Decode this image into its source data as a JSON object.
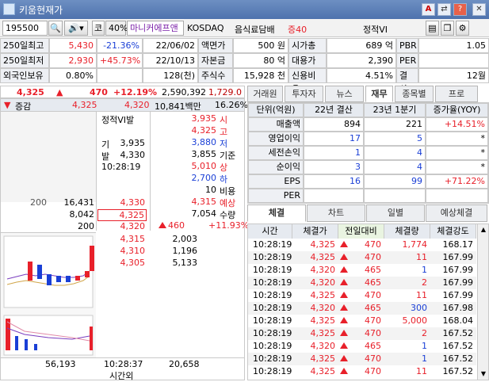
{
  "window": {
    "title": "키움현재가"
  },
  "titlebar_btns": [
    "A",
    "⇄",
    "?",
    "✕"
  ],
  "toolbar": {
    "code": "195500",
    "tag1": "코",
    "margin": "40%",
    "name": "마니커에프앤",
    "market": "KOSDAQ",
    "sector": "음식료담배",
    "rating": "증40",
    "vi": "정적VI"
  },
  "info": {
    "rows": [
      [
        "250일최고",
        "5,430",
        "-21.36%",
        "22/06/02",
        "액면가",
        "500 원",
        "시가총액",
        "689 억",
        "PBR",
        "1.05"
      ],
      [
        "250일최저",
        "2,930",
        "+45.73%",
        "22/10/13",
        "자본금",
        "80 억",
        "대용가",
        "2,390",
        "PER",
        ""
      ],
      [
        "외국인보유",
        "0.80%",
        "",
        "128(천)",
        "주식수",
        "15,928 천",
        "신용비율",
        "4.51%",
        "결산월",
        "12월"
      ]
    ]
  },
  "price": {
    "current": "4,325",
    "arrow": "▲",
    "change": "470",
    "rate": "+12.19%",
    "volume": "2,590,392",
    "prev_close": "1,729.0"
  },
  "orderbook": {
    "head": [
      "증감",
      "4,325",
      "4,320",
      "10,841백만",
      "16.26%"
    ],
    "vi_title": "정적VI발",
    "vi_rows": [
      [
        "기",
        "3,935"
      ],
      [
        "발",
        "4,330"
      ],
      [
        "10:28:19",
        ""
      ]
    ],
    "right_info": [
      [
        "3,935",
        "시"
      ],
      [
        "4,325",
        "고"
      ],
      [
        "3,880",
        "저"
      ],
      [
        "3,855",
        "기준"
      ],
      [
        "5,010",
        "상"
      ],
      [
        "2,700",
        "하"
      ],
      [
        "10",
        "비용"
      ],
      [
        "4,315",
        "예상"
      ],
      [
        "7,054",
        "수량"
      ]
    ],
    "expected_diff": "460",
    "expected_rate": "+11.93%",
    "bid_rows": [
      [
        "200",
        "16,431",
        "4,330"
      ],
      [
        "",
        "8,042",
        "4,325"
      ],
      [
        "",
        "200",
        "4,320"
      ]
    ],
    "lower": [
      [
        "4,315",
        "2,003"
      ],
      [
        "4,310",
        "1,196"
      ],
      [
        "4,305",
        "5,133"
      ]
    ],
    "total_left": "56,193",
    "time": "10:28:37",
    "total_right": "20,658",
    "after_hours": "시간외"
  },
  "tabs_top": [
    "거래원",
    "투자자",
    "뉴스",
    "재무",
    "종목별",
    "프로"
  ],
  "fin": {
    "head": [
      "단위(억원)",
      "22년 결산",
      "23년 1분기",
      "증가율(YOY)"
    ],
    "rows": [
      [
        "매출액",
        "894",
        "221",
        "+14.51%"
      ],
      [
        "영업이익",
        "17",
        "5",
        "*"
      ],
      [
        "세전손익",
        "1",
        "4",
        "*"
      ],
      [
        "순이익",
        "3",
        "4",
        "*"
      ],
      [
        "EPS",
        "16",
        "99",
        "+71.22%"
      ],
      [
        "PER",
        "",
        "",
        ""
      ]
    ]
  },
  "tabs_bottom": [
    "체결",
    "차트",
    "일별",
    "예상체결"
  ],
  "trades": {
    "head": [
      "시간",
      "체결가",
      "전일대비",
      "체결량",
      "체결강도"
    ],
    "rows": [
      [
        "10:28:19",
        "4,325",
        "470",
        "1,774",
        "168.17"
      ],
      [
        "10:28:19",
        "4,325",
        "470",
        "11",
        "167.99"
      ],
      [
        "10:28:19",
        "4,320",
        "465",
        "1",
        "167.99"
      ],
      [
        "10:28:19",
        "4,320",
        "465",
        "2",
        "167.99"
      ],
      [
        "10:28:19",
        "4,325",
        "470",
        "11",
        "167.99"
      ],
      [
        "10:28:19",
        "4,320",
        "465",
        "300",
        "167.98"
      ],
      [
        "10:28:19",
        "4,325",
        "470",
        "5,000",
        "168.04"
      ],
      [
        "10:28:19",
        "4,325",
        "470",
        "2",
        "167.52"
      ],
      [
        "10:28:19",
        "4,320",
        "465",
        "1",
        "167.52"
      ],
      [
        "10:28:19",
        "4,325",
        "470",
        "1",
        "167.52"
      ],
      [
        "10:28:19",
        "4,325",
        "470",
        "11",
        "167.52"
      ]
    ]
  },
  "colors": {
    "up": "#e8202a",
    "down": "#1a3fd6",
    "title": "#4e72ad"
  }
}
